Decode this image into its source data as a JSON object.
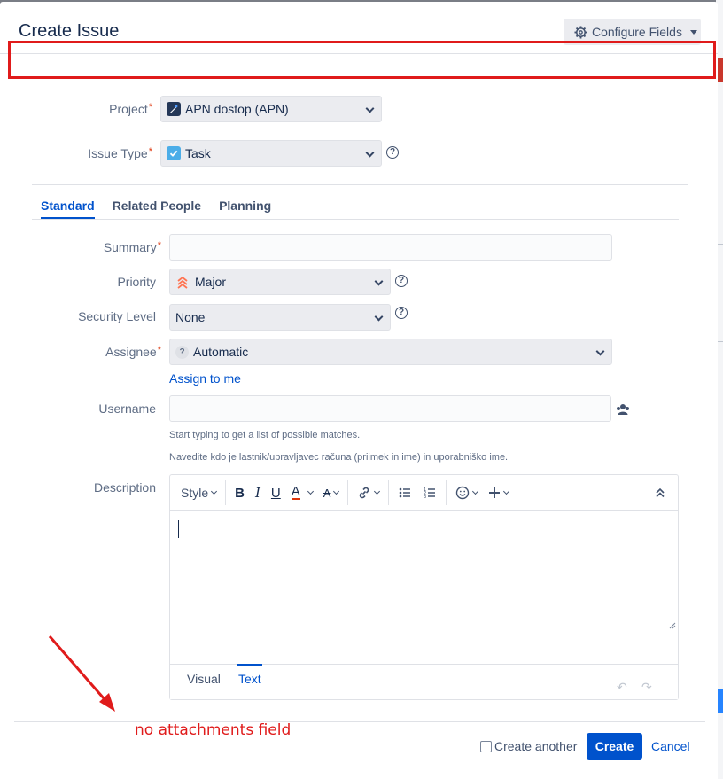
{
  "dialog": {
    "title": "Create Issue",
    "configure_label": "Configure Fields"
  },
  "form": {
    "project": {
      "label": "Project",
      "value": "APN dostop (APN)"
    },
    "issue_type": {
      "label": "Issue Type",
      "value": "Task"
    },
    "tabs": [
      {
        "label": "Standard",
        "active": true
      },
      {
        "label": "Related People",
        "active": false
      },
      {
        "label": "Planning",
        "active": false
      }
    ],
    "summary": {
      "label": "Summary",
      "value": ""
    },
    "priority": {
      "label": "Priority",
      "value": "Major"
    },
    "security": {
      "label": "Security Level",
      "value": "None"
    },
    "assignee": {
      "label": "Assignee",
      "value": "Automatic",
      "assign_link": "Assign to me"
    },
    "username": {
      "label": "Username",
      "value": "",
      "hint1": "Start typing to get a list of possible matches.",
      "hint2": "Navedite kdo je lastnik/upravljavec računa (priimek in ime) in uporabniško ime."
    },
    "description": {
      "label": "Description",
      "style_label": "Style",
      "mode_visual": "Visual",
      "mode_text": "Text"
    }
  },
  "footer": {
    "create_another": "Create another",
    "create": "Create",
    "cancel": "Cancel"
  },
  "annotation": {
    "note": "no attachments field"
  },
  "colors": {
    "primary": "#0052cc",
    "annotation": "#e01b1b",
    "required": "#de350b"
  }
}
